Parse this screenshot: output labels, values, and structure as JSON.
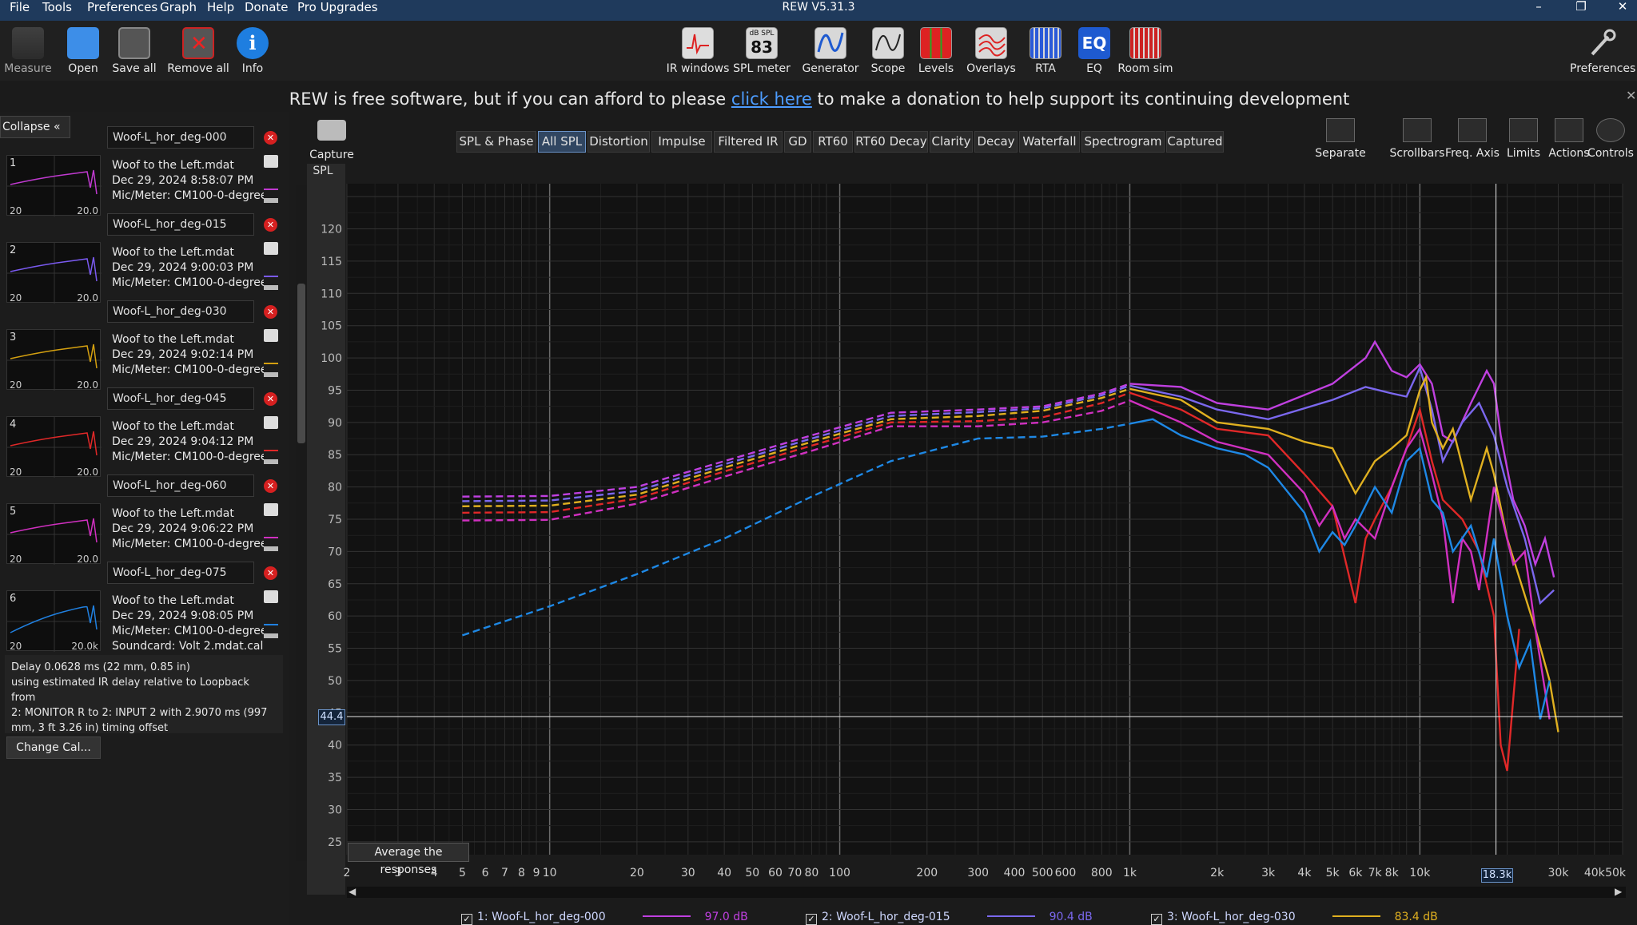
{
  "titlebar": {
    "menu": [
      "File",
      "Tools",
      "Preferences",
      "Graph",
      "Help",
      "Donate",
      "Pro Upgrades"
    ],
    "title": "REW V5.31.3"
  },
  "toolbar": {
    "left": [
      "Measure",
      "Open",
      "Save all",
      "Remove all",
      "Info"
    ],
    "center": [
      "IR windows",
      "SPL meter",
      "Generator",
      "Scope",
      "Levels",
      "Overlays",
      "RTA",
      "EQ",
      "Room sim"
    ],
    "spl_meter_value": "83",
    "spl_meter_unit": "dB SPL",
    "eq_icon_text": "EQ",
    "right": "Preferences"
  },
  "donation": {
    "before": "REW is free software, but if you can afford to please ",
    "link": "click here",
    "after": " to make a donation to help support its continuing development"
  },
  "left_panel": {
    "collapse_label": "Collapse",
    "measurements": [
      {
        "num": "1",
        "name": "Woof-L_hor_deg-000",
        "file": "Woof to the Left.mdat",
        "date": "Dec 29, 2024 8:58:07 PM",
        "mic": "Mic/Meter: CM100-0-degree",
        "color": "#c03ad0",
        "lo": "20",
        "hi": "20.0"
      },
      {
        "num": "2",
        "name": "Woof-L_hor_deg-015",
        "file": "Woof to the Left.mdat",
        "date": "Dec 29, 2024 9:00:03 PM",
        "mic": "Mic/Meter: CM100-0-degree",
        "color": "#7a5af0",
        "lo": "20",
        "hi": "20.0"
      },
      {
        "num": "3",
        "name": "Woof-L_hor_deg-030",
        "file": "Woof to the Left.mdat",
        "date": "Dec 29, 2024 9:02:14 PM",
        "mic": "Mic/Meter: CM100-0-degree",
        "color": "#d4a010",
        "lo": "20",
        "hi": "20.0"
      },
      {
        "num": "4",
        "name": "Woof-L_hor_deg-045",
        "file": "Woof to the Left.mdat",
        "date": "Dec 29, 2024 9:04:12 PM",
        "mic": "Mic/Meter: CM100-0-degree",
        "color": "#e02828",
        "lo": "20",
        "hi": "20.0"
      },
      {
        "num": "5",
        "name": "Woof-L_hor_deg-060",
        "file": "Woof to the Left.mdat",
        "date": "Dec 29, 2024 9:06:22 PM",
        "mic": "Mic/Meter: CM100-0-degree",
        "color": "#d030c0",
        "lo": "20",
        "hi": "20.0"
      },
      {
        "num": "6",
        "name": "Woof-L_hor_deg-075",
        "file": "Woof to the Left.mdat",
        "date": "Dec 29, 2024 9:08:05 PM",
        "mic": "Mic/Meter: CM100-0-degree",
        "color": "#2080e0",
        "lo": "20",
        "hi": "20.0k",
        "soundcard": "Soundcard: Volt 2.mdat.cal"
      }
    ],
    "delay_text": [
      "Delay 0.0628 ms (22 mm, 0.85 in)",
      "using estimated IR delay relative to Loopback from",
      "2: MONITOR R to 2: INPUT 2 with 2.9070 ms (997",
      "mm, 3 ft 3.26 in) timing offset"
    ],
    "change_cal": "Change Cal..."
  },
  "graph": {
    "capture_label": "Capture",
    "tabs": [
      "SPL & Phase",
      "All SPL",
      "Distortion",
      "Impulse",
      "Filtered IR",
      "GD",
      "RT60",
      "RT60 Decay",
      "Clarity",
      "Decay",
      "Waterfall",
      "Spectrogram",
      "Captured"
    ],
    "active_tab": "All SPL",
    "tools": [
      "Separate",
      "Scrollbars",
      "Freq. Axis",
      "Limits",
      "Actions",
      "Controls"
    ],
    "avg_button": "Average the responses",
    "cursor_y": "44.4",
    "cursor_x": "18.3k"
  },
  "chart_data": {
    "type": "line",
    "ylabel": "SPL",
    "xscale": "log",
    "xlim": [
      2,
      50000
    ],
    "ylim": [
      23,
      127
    ],
    "yticks": [
      25,
      30,
      35,
      40,
      45,
      50,
      55,
      60,
      65,
      70,
      75,
      80,
      85,
      90,
      95,
      100,
      105,
      110,
      115,
      120
    ],
    "xticks": [
      {
        "v": 2,
        "l": "2"
      },
      {
        "v": 3,
        "l": "3"
      },
      {
        "v": 4,
        "l": "4"
      },
      {
        "v": 5,
        "l": "5"
      },
      {
        "v": 6,
        "l": "6"
      },
      {
        "v": 7,
        "l": "7"
      },
      {
        "v": 8,
        "l": "8"
      },
      {
        "v": 9,
        "l": "9"
      },
      {
        "v": 10,
        "l": "10"
      },
      {
        "v": 20,
        "l": "20"
      },
      {
        "v": 30,
        "l": "30"
      },
      {
        "v": 40,
        "l": "40"
      },
      {
        "v": 50,
        "l": "50"
      },
      {
        "v": 60,
        "l": "60"
      },
      {
        "v": 70,
        "l": "70"
      },
      {
        "v": 80,
        "l": "80"
      },
      {
        "v": 100,
        "l": "100"
      },
      {
        "v": 200,
        "l": "200"
      },
      {
        "v": 300,
        "l": "300"
      },
      {
        "v": 400,
        "l": "400"
      },
      {
        "v": 500,
        "l": "500"
      },
      {
        "v": 600,
        "l": "600"
      },
      {
        "v": 800,
        "l": "800"
      },
      {
        "v": 1000,
        "l": "1k"
      },
      {
        "v": 2000,
        "l": "2k"
      },
      {
        "v": 3000,
        "l": "3k"
      },
      {
        "v": 4000,
        "l": "4k"
      },
      {
        "v": 5000,
        "l": "5k"
      },
      {
        "v": 6000,
        "l": "6k"
      },
      {
        "v": 7000,
        "l": "7k"
      },
      {
        "v": 8000,
        "l": "8k"
      },
      {
        "v": 10000,
        "l": "10k"
      },
      {
        "v": 30000,
        "l": "30k"
      },
      {
        "v": 40000,
        "l": "40k"
      },
      {
        "v": 50000,
        "l": "50kHz"
      }
    ],
    "cursor": {
      "x": 18300,
      "y": 44.4
    },
    "series": [
      {
        "name": "1: Woof-L_hor_deg-000",
        "color": "#c040e0",
        "legend_value": "97.0 dB",
        "points": [
          [
            5,
            78.5
          ],
          [
            10,
            78.6
          ],
          [
            20,
            80
          ],
          [
            40,
            84
          ],
          [
            80,
            88
          ],
          [
            150,
            91.5
          ],
          [
            300,
            92
          ],
          [
            500,
            92.5
          ],
          [
            800,
            94.5
          ],
          [
            1000,
            96
          ],
          [
            1500,
            95.5
          ],
          [
            2000,
            93
          ],
          [
            3000,
            92
          ],
          [
            5000,
            96
          ],
          [
            6500,
            100
          ],
          [
            7000,
            102.5
          ],
          [
            8000,
            98
          ],
          [
            9000,
            97
          ],
          [
            10000,
            99
          ],
          [
            11000,
            96
          ],
          [
            12000,
            88
          ],
          [
            13000,
            87
          ],
          [
            15000,
            93
          ],
          [
            17000,
            98
          ],
          [
            18000,
            96
          ],
          [
            19000,
            88
          ],
          [
            21000,
            78
          ],
          [
            23000,
            74
          ],
          [
            25000,
            68
          ],
          [
            27000,
            72
          ],
          [
            29000,
            66
          ]
        ]
      },
      {
        "name": "2: Woof-L_hor_deg-015",
        "color": "#7b68ee",
        "legend_value": "90.4 dB",
        "points": [
          [
            5,
            77.8
          ],
          [
            10,
            77.9
          ],
          [
            20,
            79.4
          ],
          [
            40,
            83.5
          ],
          [
            80,
            87.5
          ],
          [
            150,
            91
          ],
          [
            300,
            91.6
          ],
          [
            500,
            92.2
          ],
          [
            800,
            94.2
          ],
          [
            1000,
            95.7
          ],
          [
            1500,
            94
          ],
          [
            2000,
            92
          ],
          [
            3000,
            90.5
          ],
          [
            5000,
            93.5
          ],
          [
            6500,
            95.5
          ],
          [
            8000,
            94.5
          ],
          [
            9000,
            94
          ],
          [
            10000,
            98.5
          ],
          [
            11000,
            92
          ],
          [
            12000,
            84
          ],
          [
            14000,
            90
          ],
          [
            16000,
            93
          ],
          [
            18000,
            88
          ],
          [
            20000,
            80
          ],
          [
            23000,
            72
          ],
          [
            26000,
            62
          ],
          [
            29000,
            64
          ]
        ]
      },
      {
        "name": "3: Woof-L_hor_deg-030",
        "color": "#e0b020",
        "legend_value": "83.4 dB",
        "points": [
          [
            5,
            77
          ],
          [
            10,
            77.1
          ],
          [
            20,
            78.8
          ],
          [
            40,
            83
          ],
          [
            80,
            87
          ],
          [
            150,
            90.5
          ],
          [
            300,
            91
          ],
          [
            500,
            91.8
          ],
          [
            800,
            93.8
          ],
          [
            1000,
            95.2
          ],
          [
            1500,
            93.5
          ],
          [
            2000,
            90
          ],
          [
            3000,
            89
          ],
          [
            4000,
            87
          ],
          [
            5000,
            86
          ],
          [
            6000,
            79
          ],
          [
            7000,
            84
          ],
          [
            8000,
            86
          ],
          [
            9000,
            88
          ],
          [
            10000,
            95
          ],
          [
            10500,
            97
          ],
          [
            11000,
            90
          ],
          [
            12000,
            86
          ],
          [
            13000,
            89
          ],
          [
            15000,
            78
          ],
          [
            17000,
            86
          ],
          [
            18000,
            82
          ],
          [
            20000,
            72
          ],
          [
            22000,
            66
          ],
          [
            25000,
            58
          ],
          [
            28000,
            50
          ],
          [
            30000,
            42
          ]
        ]
      },
      {
        "name": "4: Woof-L_hor_deg-045",
        "color": "#e02828",
        "legend_value": "",
        "points": [
          [
            5,
            76
          ],
          [
            10,
            76.1
          ],
          [
            20,
            78.2
          ],
          [
            40,
            82.4
          ],
          [
            80,
            86.4
          ],
          [
            150,
            90
          ],
          [
            300,
            90.2
          ],
          [
            500,
            90.8
          ],
          [
            800,
            93
          ],
          [
            1000,
            94.6
          ],
          [
            1500,
            92
          ],
          [
            2000,
            89
          ],
          [
            3000,
            88
          ],
          [
            4000,
            82
          ],
          [
            5000,
            77
          ],
          [
            6000,
            62
          ],
          [
            6500,
            72
          ],
          [
            7000,
            75
          ],
          [
            8000,
            80
          ],
          [
            9000,
            86
          ],
          [
            10000,
            92
          ],
          [
            11000,
            84
          ],
          [
            12000,
            78
          ],
          [
            14000,
            75
          ],
          [
            16000,
            70
          ],
          [
            18000,
            60
          ],
          [
            19000,
            40
          ],
          [
            20000,
            36
          ],
          [
            22000,
            58
          ]
        ]
      },
      {
        "name": "5: Woof-L_hor_deg-060",
        "color": "#d030c0",
        "legend_value": "",
        "points": [
          [
            5,
            74.8
          ],
          [
            10,
            74.9
          ],
          [
            20,
            77.4
          ],
          [
            40,
            81.6
          ],
          [
            80,
            85.6
          ],
          [
            150,
            89.4
          ],
          [
            300,
            89.4
          ],
          [
            500,
            90
          ],
          [
            800,
            91.8
          ],
          [
            1000,
            93.4
          ],
          [
            1500,
            90
          ],
          [
            2000,
            87
          ],
          [
            3000,
            85
          ],
          [
            4000,
            79
          ],
          [
            4500,
            74
          ],
          [
            5000,
            77
          ],
          [
            5500,
            72
          ],
          [
            6000,
            75
          ],
          [
            7000,
            72
          ],
          [
            8000,
            80
          ],
          [
            9000,
            86
          ],
          [
            10000,
            89
          ],
          [
            11000,
            82
          ],
          [
            12000,
            75
          ],
          [
            13000,
            62
          ],
          [
            14000,
            72
          ],
          [
            15000,
            70
          ],
          [
            16000,
            64
          ],
          [
            18000,
            80
          ],
          [
            19000,
            76
          ],
          [
            21000,
            68
          ],
          [
            23000,
            70
          ],
          [
            25000,
            58
          ],
          [
            28000,
            44
          ]
        ]
      },
      {
        "name": "6: Woof-L_hor_deg-075",
        "color": "#1e88e5",
        "legend_value": "",
        "points": [
          [
            5,
            57
          ],
          [
            10,
            61.5
          ],
          [
            20,
            66.5
          ],
          [
            40,
            72
          ],
          [
            80,
            78.5
          ],
          [
            150,
            84
          ],
          [
            300,
            87.5
          ],
          [
            500,
            87.8
          ],
          [
            800,
            89
          ],
          [
            1000,
            89.8
          ],
          [
            1200,
            90.5
          ],
          [
            1500,
            88
          ],
          [
            2000,
            86
          ],
          [
            2500,
            85
          ],
          [
            3000,
            83
          ],
          [
            4000,
            76
          ],
          [
            4500,
            70
          ],
          [
            5000,
            73
          ],
          [
            5500,
            71
          ],
          [
            6000,
            74
          ],
          [
            7000,
            80
          ],
          [
            8000,
            76
          ],
          [
            9000,
            84
          ],
          [
            10000,
            86
          ],
          [
            11000,
            78
          ],
          [
            12000,
            76
          ],
          [
            13000,
            70
          ],
          [
            15000,
            74
          ],
          [
            17000,
            66
          ],
          [
            18000,
            72
          ],
          [
            20000,
            60
          ],
          [
            22000,
            52
          ],
          [
            24000,
            56
          ],
          [
            26000,
            44
          ],
          [
            28000,
            50
          ]
        ]
      }
    ]
  }
}
